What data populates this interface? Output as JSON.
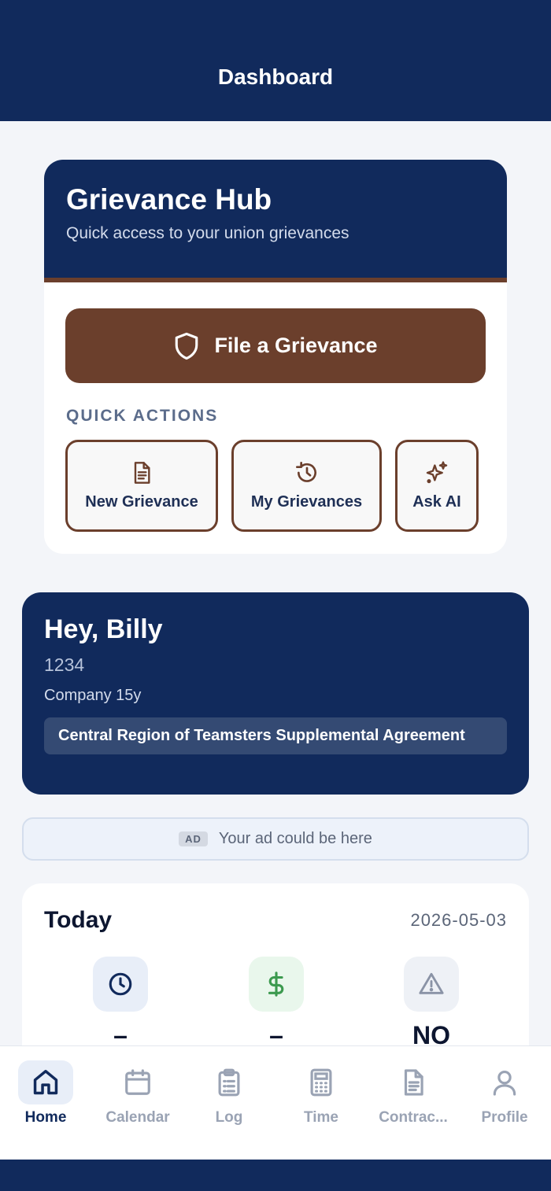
{
  "header": {
    "title": "Dashboard"
  },
  "hub": {
    "title": "Grievance Hub",
    "subtitle": "Quick access to your union grievances",
    "file_button": "File a Grievance",
    "quick_actions_label": "QUICK ACTIONS",
    "actions": [
      {
        "label": "New Grievance",
        "icon": "document-icon"
      },
      {
        "label": "My Grievances",
        "icon": "history-icon"
      },
      {
        "label": "Ask AI",
        "icon": "sparkle-icon"
      }
    ]
  },
  "user": {
    "greeting": "Hey, Billy",
    "id": "1234",
    "company": "Company 15y",
    "agreement": "Central Region of Teamsters Supplemental Agreement"
  },
  "ad": {
    "badge": "AD",
    "text": "Your ad could be here"
  },
  "today": {
    "title": "Today",
    "date": "2026-05-03",
    "stats": [
      {
        "icon": "clock-icon",
        "value": "–"
      },
      {
        "icon": "dollar-icon",
        "value": "–"
      },
      {
        "icon": "warning-icon",
        "value": "NO"
      }
    ]
  },
  "tabs": [
    {
      "label": "Home",
      "icon": "home-icon",
      "active": true
    },
    {
      "label": "Calendar",
      "icon": "calendar-icon"
    },
    {
      "label": "Log",
      "icon": "clipboard-icon"
    },
    {
      "label": "Time",
      "icon": "calculator-icon"
    },
    {
      "label": "Contrac...",
      "icon": "contract-icon"
    },
    {
      "label": "Profile",
      "icon": "profile-icon"
    }
  ],
  "colors": {
    "navy": "#112a5c",
    "brown": "#6b3f2c",
    "green": "#3c9a4f"
  }
}
